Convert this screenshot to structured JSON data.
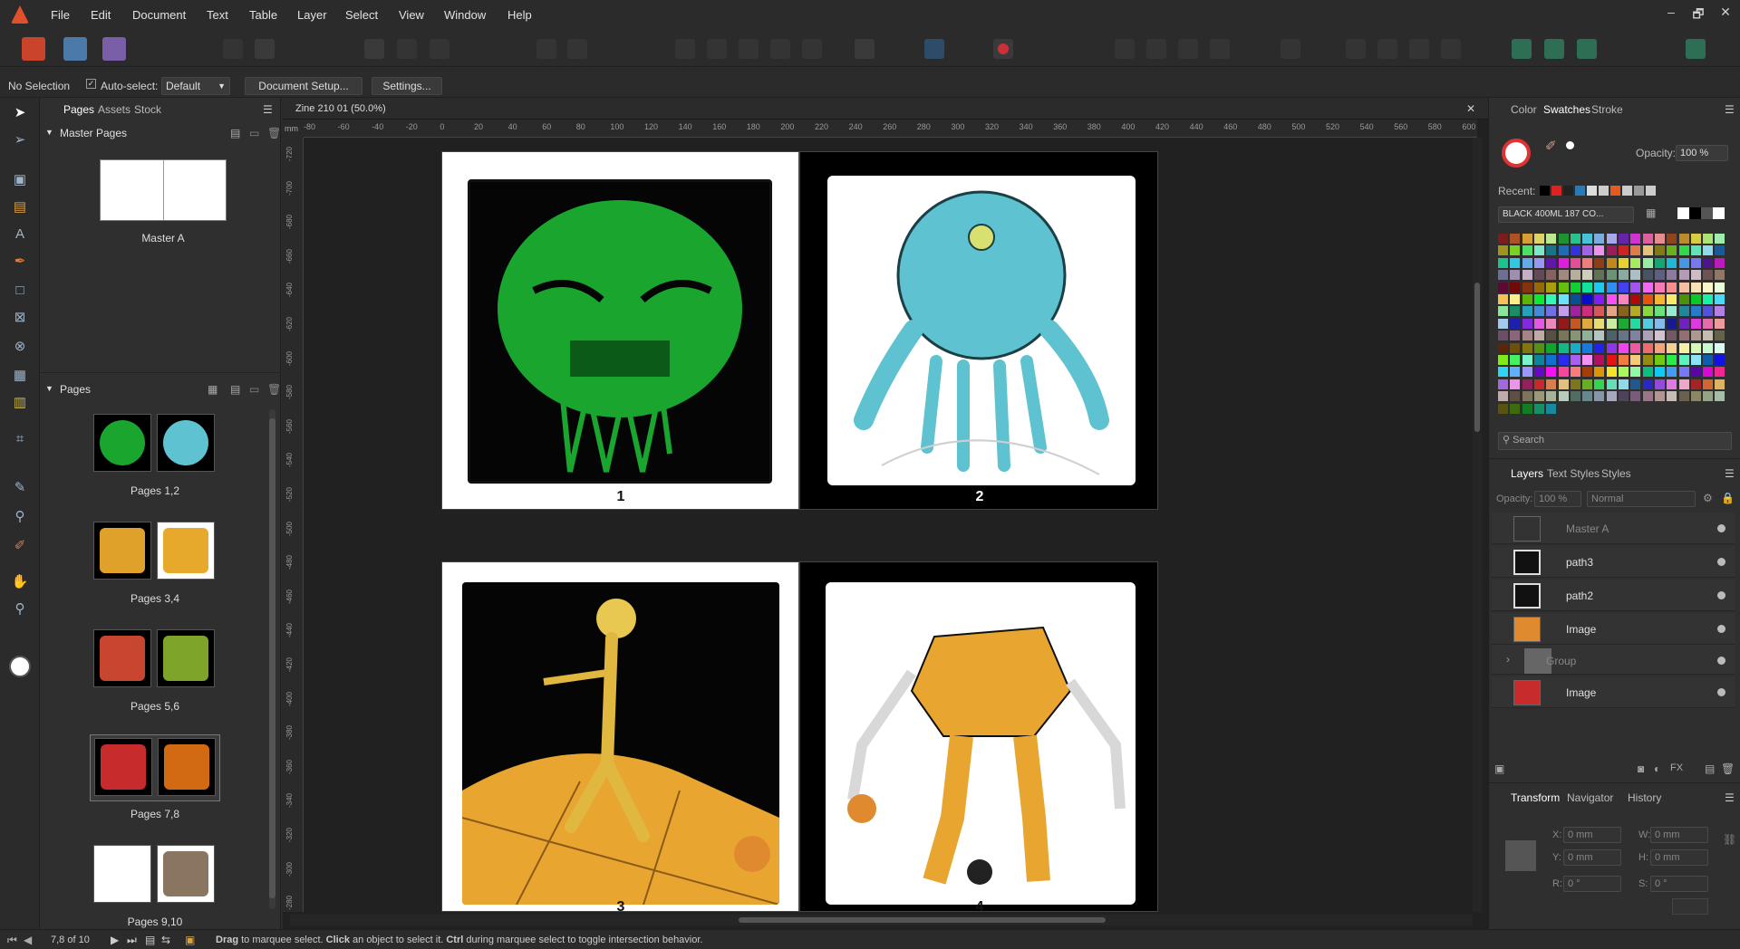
{
  "menu": [
    "File",
    "Edit",
    "Document",
    "Text",
    "Table",
    "Layer",
    "Select",
    "View",
    "Window",
    "Help"
  ],
  "window_controls": [
    "–",
    "🗗",
    "✕"
  ],
  "context": {
    "selection": "No Selection",
    "autoselect_label": "Auto-select:",
    "autoselect_value": "Default",
    "document_setup": "Document Setup...",
    "settings": "Settings..."
  },
  "left_panel": {
    "tabs": [
      "Pages",
      "Assets",
      "Stock"
    ],
    "master_section": "Master Pages",
    "master_name": "Master A",
    "pages_section": "Pages",
    "spreads": [
      {
        "label": "Pages 1,2",
        "left_color": "#1aa52e",
        "right_color": "#5fc2d0"
      },
      {
        "label": "Pages 3,4",
        "left_color": "#e0a12a",
        "right_color": "#e6a92c"
      },
      {
        "label": "Pages 5,6",
        "left_color": "#c8462f",
        "right_color": "#7ea42a"
      },
      {
        "label": "Pages 7,8",
        "left_color": "#c72b2b",
        "right_color": "#d16a12"
      },
      {
        "label": "Pages 9,10",
        "left_color": "#ffffff",
        "right_color": "#8a7560"
      }
    ]
  },
  "document": {
    "tab_title": "Zine 210 01 (50.0%)",
    "ruler_unit": "mm",
    "h_ticks": [
      "-80",
      "-60",
      "-40",
      "-20",
      "0",
      "20",
      "40",
      "60",
      "80",
      "100",
      "120",
      "140",
      "160",
      "180",
      "200",
      "220",
      "240",
      "260",
      "280",
      "300",
      "320",
      "340",
      "360",
      "380",
      "400",
      "420",
      "440",
      "460",
      "480",
      "500",
      "520",
      "540",
      "560",
      "580",
      "600"
    ],
    "v_ticks": [
      "-720",
      "-700",
      "-680",
      "-660",
      "-640",
      "-620",
      "-600",
      "-580",
      "-560",
      "-540",
      "-520",
      "-500",
      "-480",
      "-460",
      "-440",
      "-420",
      "-400",
      "-380",
      "-360",
      "-340",
      "-320",
      "-300",
      "-280"
    ],
    "pages": [
      {
        "num": "1"
      },
      {
        "num": "2"
      },
      {
        "num": "3"
      },
      {
        "num": "4"
      }
    ]
  },
  "right_panel": {
    "top_tabs": [
      "Color",
      "Swatches",
      "Stroke"
    ],
    "opacity_label": "Opacity:",
    "opacity_value": "100 %",
    "recent_label": "Recent:",
    "palette_name": "BLACK 400ML 187 CO...",
    "search_placeholder": "Search",
    "layer_tabs": [
      "Layers",
      "Text Styles",
      "Styles"
    ],
    "layer_opacity_label": "Opacity:",
    "layer_opacity_value": "100 %",
    "blend_mode": "Normal",
    "layers": [
      "Master A",
      "path3",
      "path2",
      "Image",
      "Group",
      "Image"
    ],
    "transform_tabs": [
      "Transform",
      "Navigator",
      "History"
    ],
    "transform": {
      "x_label": "X:",
      "x": "0 mm",
      "y_label": "Y:",
      "y": "0 mm",
      "w_label": "W:",
      "w": "0 mm",
      "h_label": "H:",
      "h": "0 mm",
      "r_label": "R:",
      "r": "0 °",
      "s_label": "S:",
      "s": "0 °"
    }
  },
  "status": {
    "page_indicator": "7,8 of 10",
    "hint_1": "Drag",
    "hint_2": " to marquee select. ",
    "hint_3": "Click",
    "hint_4": " an object to select it. ",
    "hint_5": "Ctrl",
    "hint_6": " during marquee select to toggle intersection behavior."
  },
  "colors": {
    "accent": "#4a90d9",
    "green_art": "#1aa52e",
    "cyan_art": "#5fc2d0",
    "orange_art": "#e8a630"
  }
}
